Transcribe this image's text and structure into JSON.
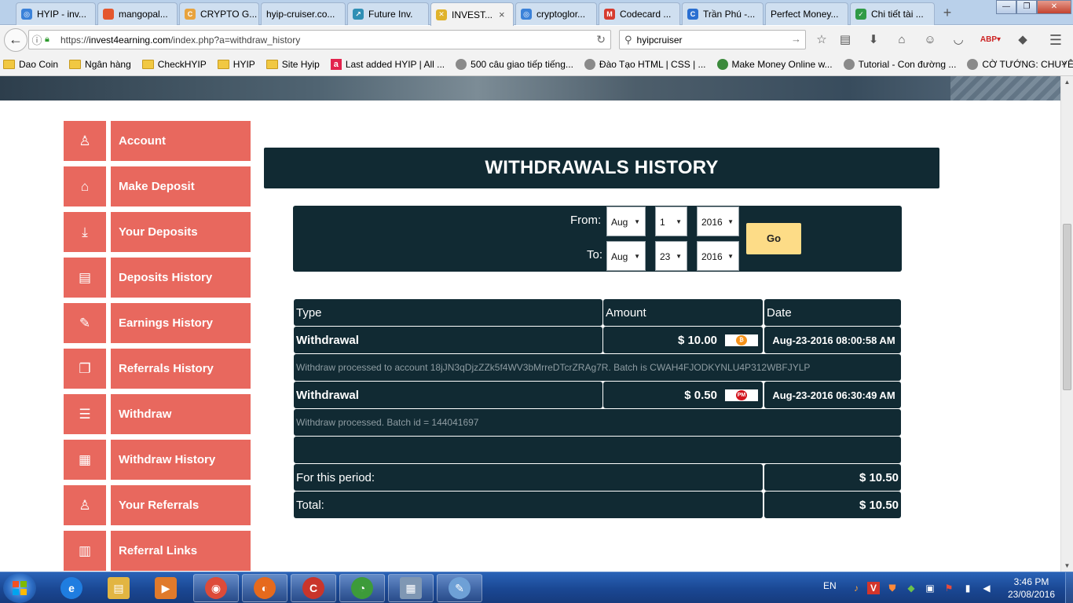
{
  "browser": {
    "tabs": [
      {
        "label": "HYIP - inv...",
        "icon": "hyip-globe-icon",
        "color": "#3b82d9"
      },
      {
        "label": "mangopal...",
        "icon": "mango-icon",
        "color": "#e4572e"
      },
      {
        "label": "CRYPTO G...",
        "icon": "crypto-icon",
        "color": "#e8a33d"
      },
      {
        "label": "hyip-cruiser.co...",
        "icon": "",
        "color": ""
      },
      {
        "label": "Future Inv.",
        "icon": "future-icon",
        "color": "#2f8fb5"
      },
      {
        "label": "INVEST...",
        "icon": "invest-icon",
        "color": "#e0b32b",
        "active": true
      },
      {
        "label": "cryptoglor...",
        "icon": "cryptoglory-icon",
        "color": "#3b82d9"
      },
      {
        "label": "Codecard ...",
        "icon": "gmail-icon",
        "color": "#d63b2f"
      },
      {
        "label": "Trần Phú -...",
        "icon": "c-icon",
        "color": "#2a6fd1"
      },
      {
        "label": "Perfect Money...",
        "icon": "",
        "color": ""
      },
      {
        "label": "Chi tiết tài ...",
        "icon": "shield-icon",
        "color": "#2f9b46"
      }
    ],
    "url": {
      "prefix": "https://",
      "host": "invest4earning.com",
      "path": "/index.php?a=withdraw_history"
    },
    "search": {
      "value": "hyipcruiser"
    },
    "bookmarks": [
      {
        "label": "Dao Coin",
        "kind": "folder"
      },
      {
        "label": "Ngân hàng",
        "kind": "folder"
      },
      {
        "label": "CheckHYIP",
        "kind": "folder"
      },
      {
        "label": "HYIP",
        "kind": "folder"
      },
      {
        "label": "Site Hyip",
        "kind": "folder"
      },
      {
        "label": "Last added HYIP | All ...",
        "kind": "a"
      },
      {
        "label": "500 câu giao tiếp tiếng...",
        "kind": "globe"
      },
      {
        "label": "Đào Tạo HTML | CSS | ...",
        "kind": "globe"
      },
      {
        "label": "Make Money Online w...",
        "kind": "money"
      },
      {
        "label": "Tutorial - Con đường ...",
        "kind": "globe"
      },
      {
        "label": "CỜ TƯỚNG: CHUYÊN ...",
        "kind": "globe"
      }
    ],
    "more": "»"
  },
  "sidebar": {
    "items": [
      {
        "label": "Account",
        "icon": "user-icon",
        "glyph": "♙"
      },
      {
        "label": "Make Deposit",
        "icon": "bank-icon",
        "glyph": "⌂"
      },
      {
        "label": "Your Deposits",
        "icon": "download-icon",
        "glyph": "⤓"
      },
      {
        "label": "Deposits History",
        "icon": "document-icon",
        "glyph": "▤"
      },
      {
        "label": "Earnings History",
        "icon": "edit-icon",
        "glyph": "✎"
      },
      {
        "label": "Referrals History",
        "icon": "copy-icon",
        "glyph": "❐"
      },
      {
        "label": "Withdraw",
        "icon": "list-icon",
        "glyph": "☰"
      },
      {
        "label": "Withdraw History",
        "icon": "calendar-icon",
        "glyph": "▦"
      },
      {
        "label": "Your Referrals",
        "icon": "user-icon",
        "glyph": "♙"
      },
      {
        "label": "Referral Links",
        "icon": "grid-icon",
        "glyph": "▥"
      }
    ]
  },
  "page": {
    "title": "WITHDRAWALS HISTORY",
    "filter": {
      "from_label": "From:",
      "to_label": "To:",
      "from": {
        "month": "Aug",
        "day": "1",
        "year": "2016"
      },
      "to": {
        "month": "Aug",
        "day": "23",
        "year": "2016"
      },
      "go_label": "Go"
    },
    "table": {
      "headers": {
        "type": "Type",
        "amount": "Amount",
        "date": "Date"
      },
      "rows": [
        {
          "type": "Withdrawal",
          "amount": "$ 10.00",
          "processor": "bitcoin-icon",
          "processor_color": "#f7931a",
          "processor_mark": "₿",
          "date": "Aug-23-2016 08:00:58 AM",
          "note": "Withdraw processed to account 18jJN3qDjzZZk5f4WV3bMrreDTcrZRAg7R. Batch is CWAH4FJODKYNLU4P312WBFJYLP"
        },
        {
          "type": "Withdrawal",
          "amount": "$ 0.50",
          "processor": "perfect-money-icon",
          "processor_color": "#d3141d",
          "processor_mark": "PM",
          "date": "Aug-23-2016 06:30:49 AM",
          "note": "Withdraw processed. Batch id = 144041697"
        }
      ],
      "period_label": "For this period:",
      "period_value": "$ 10.50",
      "total_label": "Total:",
      "total_value": "$ 10.50"
    }
  },
  "taskbar": {
    "apps": [
      {
        "name": "internet-explorer-icon",
        "color": "#1f7de0",
        "glyph": "e"
      },
      {
        "name": "file-explorer-icon",
        "color": "#e2b542",
        "glyph": "▤"
      },
      {
        "name": "media-player-icon",
        "color": "#e07a2b",
        "glyph": "▶"
      },
      {
        "name": "chrome-icon",
        "color": "#dd4b39",
        "glyph": "◉"
      },
      {
        "name": "firefox-icon",
        "color": "#e66a1d",
        "glyph": "◐"
      },
      {
        "name": "ccleaner-icon",
        "color": "#c9352b",
        "glyph": "C"
      },
      {
        "name": "coccoc-icon",
        "color": "#3d9b3a",
        "glyph": "◔"
      },
      {
        "name": "calculator-icon",
        "color": "#7f97b3",
        "glyph": "▦"
      },
      {
        "name": "paint-icon",
        "color": "#6ea0d6",
        "glyph": "✎"
      }
    ],
    "language": "EN",
    "time": "3:46 PM",
    "date": "23/08/2016"
  }
}
